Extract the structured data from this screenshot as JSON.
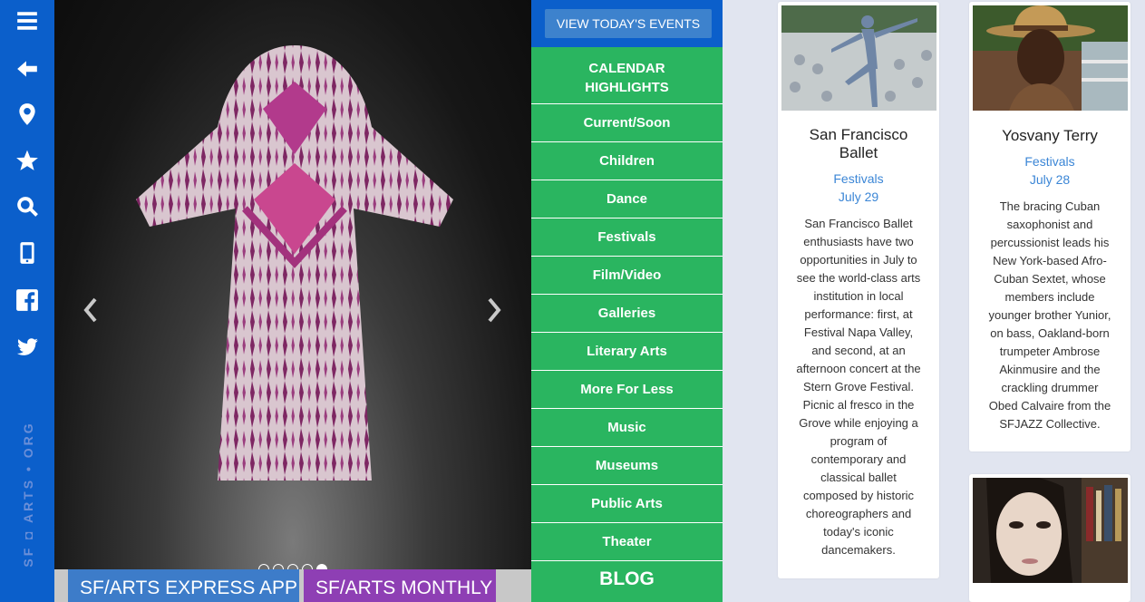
{
  "sidebar": {
    "icons": [
      "menu-icon",
      "back-arrow-icon",
      "location-pin-icon",
      "star-icon",
      "search-icon",
      "mobile-phone-icon",
      "facebook-icon",
      "twitter-icon"
    ],
    "logo_text": "SF ◘ ARTS • ORG"
  },
  "slideshow": {
    "image": "ikat robe on display",
    "dot_count": 5,
    "active_dot": 5,
    "express_button": "SF/ARTS EXPRESS APP",
    "monthly_button": "SF/ARTS MONTHLY"
  },
  "menu": {
    "view_events": "VIEW TODAY'S EVENTS",
    "heading_line1": "CALENDAR",
    "heading_line2": "HIGHLIGHTS",
    "items": [
      "Current/Soon",
      "Children",
      "Dance",
      "Festivals",
      "Film/Video",
      "Galleries",
      "Literary Arts",
      "More For Less",
      "Music",
      "Museums",
      "Public Arts",
      "Theater"
    ],
    "blog": "BLOG"
  },
  "cards": [
    {
      "title_line1": "San Francisco",
      "title_line2": "Ballet",
      "category": "Festivals",
      "date": "July 29",
      "description_lines": [
        "San Francisco Ballet",
        "enthusiasts have two",
        "opportunities in July to",
        "see the world-class arts",
        "institution in local",
        "performance: first, at",
        "Festival Napa Valley,",
        "and second, at an",
        "afternoon concert at the",
        "Stern Grove Festival.",
        "Picnic al fresco in the",
        "Grove while enjoying a",
        "program of",
        "contemporary and",
        "classical ballet",
        "composed by historic",
        "choreographers and",
        "today's iconic",
        "dancemakers."
      ]
    },
    {
      "title": "Yosvany Terry",
      "category": "Festivals",
      "date": "July 28",
      "description_lines": [
        "The bracing Cuban",
        "saxophonist and",
        "percussionist leads his",
        "New York-based Afro-",
        "Cuban Sextet, whose",
        "members include",
        "younger brother Yunior,",
        "on bass, Oakland-born",
        "trumpeter Ambrose",
        "Akinmusire and the",
        "crackling drummer",
        "Obed Calvaire from the",
        "SFJAZZ Collective."
      ]
    }
  ],
  "colors": {
    "sidebar_blue": "#0b5fcb",
    "menu_green": "#2ab560",
    "link_blue": "#3b86d6",
    "monthly_purple": "#8e3fb4",
    "express_blue": "#3d7cc9",
    "page_bg": "#e1e5f0"
  }
}
